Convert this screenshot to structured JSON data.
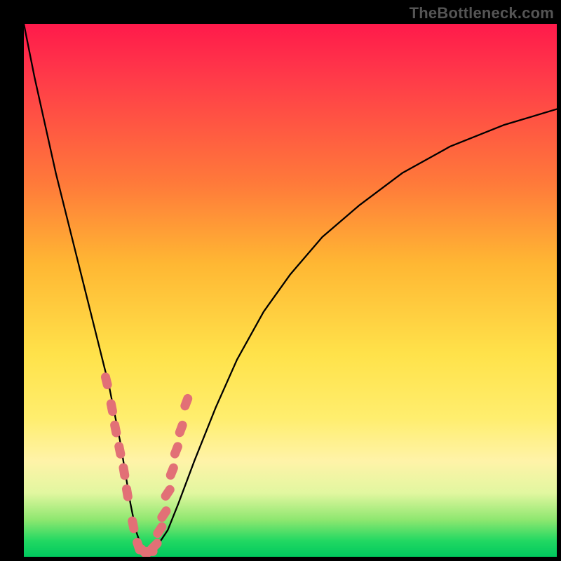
{
  "watermark": "TheBottleneck.com",
  "chart_data": {
    "type": "line",
    "title": "",
    "xlabel": "",
    "ylabel": "",
    "xlim": [
      0,
      100
    ],
    "ylim": [
      0,
      100
    ],
    "series": [
      {
        "name": "bottleneck-curve",
        "x": [
          0,
          2,
          4,
          6,
          8,
          10,
          12,
          14,
          16,
          18,
          19,
          20,
          21,
          22,
          23,
          24,
          25,
          27,
          29,
          32,
          36,
          40,
          45,
          50,
          56,
          63,
          71,
          80,
          90,
          100
        ],
        "y": [
          100,
          90,
          81,
          72,
          64,
          56,
          48,
          40,
          32,
          22,
          16,
          10,
          5,
          2,
          1,
          1,
          2,
          5,
          10,
          18,
          28,
          37,
          46,
          53,
          60,
          66,
          72,
          77,
          81,
          84
        ]
      }
    ],
    "markers": {
      "name": "sample-points",
      "color": "#e27076",
      "x": [
        15.5,
        16.5,
        17.2,
        18.0,
        18.8,
        19.4,
        20.5,
        21.5,
        22.5,
        23.5,
        24.5,
        25.5,
        26.3,
        27.0,
        27.8,
        28.6,
        29.5,
        30.5
      ],
      "y": [
        33,
        28,
        24,
        20,
        16,
        12,
        6,
        2,
        1,
        1,
        2,
        5,
        8,
        12,
        16,
        20,
        24,
        29
      ]
    },
    "gradient_stops": [
      {
        "pos": 0.0,
        "color": "#ff1a4b"
      },
      {
        "pos": 0.3,
        "color": "#ff7a3a"
      },
      {
        "pos": 0.62,
        "color": "#ffe24a"
      },
      {
        "pos": 0.88,
        "color": "#e2f7a0"
      },
      {
        "pos": 1.0,
        "color": "#00c95e"
      }
    ]
  }
}
